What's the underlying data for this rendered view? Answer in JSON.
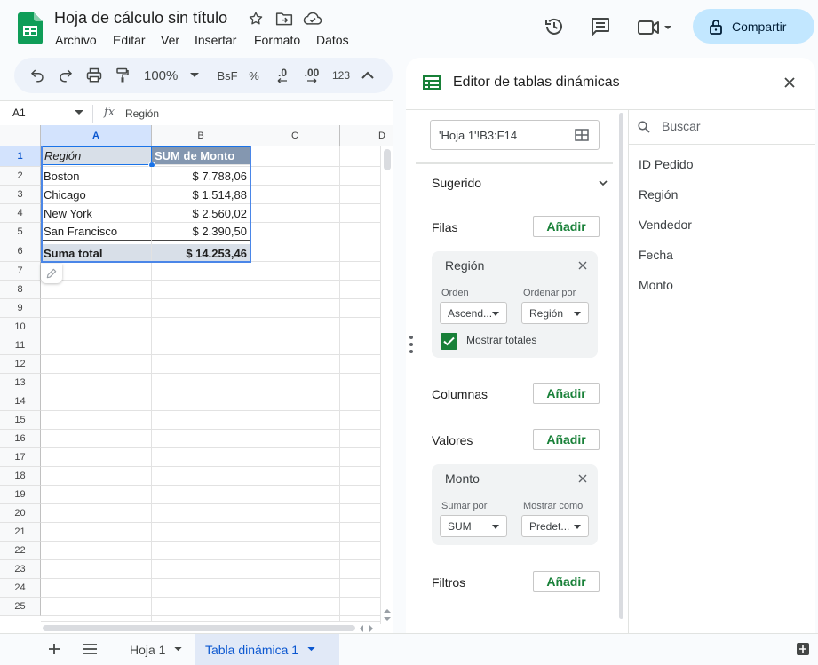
{
  "header": {
    "doc_title": "Hoja de cálculo sin título",
    "menu": [
      "Archivo",
      "Editar",
      "Ver",
      "Insertar",
      "Formato",
      "Datos"
    ],
    "share_label": "Compartir"
  },
  "toolbar": {
    "zoom": "100%",
    "format_currency": "BsF",
    "format_percent": "%",
    "decrease_decimals": ".0",
    "increase_decimals": ".00",
    "more_formats": "123"
  },
  "formula_bar": {
    "cell_ref": "A1",
    "fx": "fx",
    "content": "Región"
  },
  "grid": {
    "columns": [
      "A",
      "B",
      "C",
      "D"
    ],
    "rows": [
      "1",
      "2",
      "3",
      "4",
      "5",
      "6",
      "7",
      "8",
      "9",
      "10",
      "11",
      "12",
      "13",
      "14",
      "15",
      "16",
      "17",
      "18",
      "19",
      "20",
      "21",
      "22",
      "23",
      "24",
      "25"
    ],
    "pivot": {
      "header": [
        "Región",
        "SUM de Monto"
      ],
      "data": [
        [
          "Boston",
          "$ 7.788,06"
        ],
        [
          "Chicago",
          "$ 1.514,88"
        ],
        [
          "New York",
          "$ 2.560,02"
        ],
        [
          "San Francisco",
          "$ 2.390,50"
        ]
      ],
      "total": [
        "Suma total",
        "$ 14.253,46"
      ]
    }
  },
  "tabs": {
    "sheets": [
      "Hoja 1",
      "Tabla dinámica 1"
    ],
    "active_index": 1
  },
  "panel": {
    "title": "Editor de tablas dinámicas",
    "range": "'Hoja 1'!B3:F14",
    "suggested": "Sugerido",
    "rows_label": "Filas",
    "columns_label": "Columnas",
    "values_label": "Valores",
    "filters_label": "Filtros",
    "add_label": "Añadir",
    "row_card": {
      "title": "Región",
      "order_label": "Orden",
      "order_value": "Ascend...",
      "sort_by_label": "Ordenar por",
      "sort_by_value": "Región",
      "show_totals": "Mostrar totales",
      "show_totals_checked": true
    },
    "value_card": {
      "title": "Monto",
      "summarize_label": "Sumar por",
      "summarize_value": "SUM",
      "show_as_label": "Mostrar como",
      "show_as_value": "Predet..."
    },
    "search_placeholder": "Buscar",
    "fields": [
      "ID Pedido",
      "Región",
      "Vendedor",
      "Fecha",
      "Monto"
    ]
  },
  "colors": {
    "accent_green": "#188038",
    "share_bg": "#c2e7ff",
    "pivot_header_bg": "#8497b0",
    "selection_blue": "#1a73e8"
  }
}
